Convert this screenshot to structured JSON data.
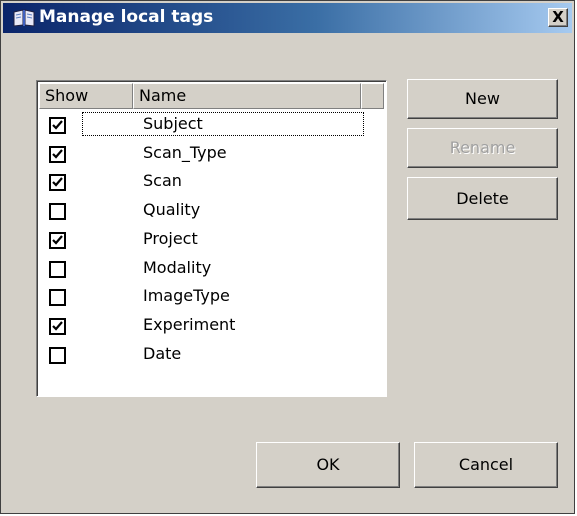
{
  "dialog": {
    "title": "Manage local tags",
    "close_label": "X"
  },
  "list": {
    "columns": [
      "Show",
      "Name"
    ],
    "rows": [
      {
        "name": "Subject",
        "checked": true
      },
      {
        "name": "Scan_Type",
        "checked": true
      },
      {
        "name": "Scan",
        "checked": true
      },
      {
        "name": "Quality",
        "checked": false
      },
      {
        "name": "Project",
        "checked": true
      },
      {
        "name": "Modality",
        "checked": false
      },
      {
        "name": "ImageType",
        "checked": false
      },
      {
        "name": "Experiment",
        "checked": true
      },
      {
        "name": "Date",
        "checked": false
      }
    ],
    "focused_row": 0
  },
  "buttons": {
    "new_label": "New",
    "rename_label": "Rename",
    "delete_label": "Delete",
    "ok_label": "OK",
    "cancel_label": "Cancel"
  },
  "colors": {
    "title_gradient_start": "#0a246a",
    "title_gradient_end": "#a6caf0",
    "dialog_background": "#d4d0c8",
    "disabled_text": "#a0a0a0"
  }
}
